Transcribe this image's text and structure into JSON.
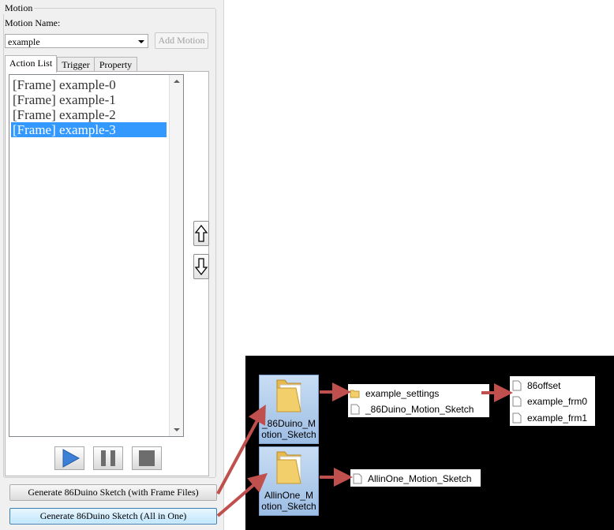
{
  "motion_panel": {
    "group_title": "Motion",
    "name_label": "Motion Name:",
    "name_value": "example",
    "add_button": "Add Motion",
    "tabs": [
      "Action List",
      "Trigger",
      "Property"
    ],
    "action_list": [
      "[Frame] example-0",
      "[Frame] example-1",
      "[Frame] example-2",
      "[Frame] example-3"
    ],
    "selected_index": 3
  },
  "buttons": {
    "gen_frame_files": "Generate 86Duino Sketch (with Frame Files)",
    "gen_all_in_one": "Generate 86Duino Sketch (All in One)"
  },
  "files": {
    "folder1": "_86Duino_M\notion_Sketch",
    "folder2": "AllinOne_M\notion_Sketch",
    "folder1_contents": [
      "example_settings",
      "_86Duino_Motion_Sketch"
    ],
    "settings_contents": [
      "86offset",
      "example_frm0",
      "example_frm1"
    ],
    "folder2_contents": [
      "AllinOne_Motion_Sketch"
    ]
  },
  "colors": {
    "selection": "#3399ff",
    "arrow": "#c0504d",
    "play_blue": "#3b7fd6",
    "folder_yellow": "#f2cf6a"
  }
}
